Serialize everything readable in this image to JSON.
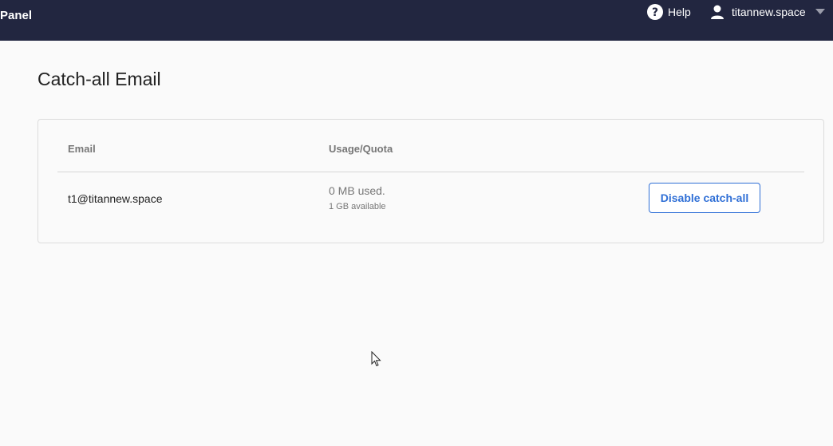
{
  "header": {
    "brand": "Panel",
    "help_label": "Help",
    "user_label": "titannew.space",
    "background": "#222640"
  },
  "page": {
    "title": "Catch-all Email"
  },
  "table": {
    "columns": [
      "Email",
      "Usage/Quota"
    ],
    "row": {
      "email": "t1@titannew.space",
      "usage": "0 MB used.",
      "quota": "1 GB available",
      "action_label": "Disable catch-all"
    }
  },
  "colors": {
    "accent": "#2f6fd6",
    "muted_text": "#777777"
  },
  "icons": [
    "help-icon",
    "user-icon",
    "caret-down-icon",
    "mouse-cursor-icon"
  ]
}
